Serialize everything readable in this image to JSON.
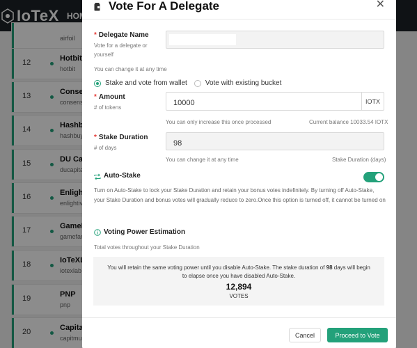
{
  "app": {
    "logo_text": "IoTeX",
    "nav_home": "HOM"
  },
  "list": {
    "top_sub": "airfoil",
    "rows": [
      {
        "rank": "12",
        "name": "Hotbit",
        "sub": "hotbit"
      },
      {
        "rank": "13",
        "name": "Consen",
        "sub": "consensu"
      },
      {
        "rank": "14",
        "name": "Hashbu",
        "sub": "hashbuy"
      },
      {
        "rank": "15",
        "name": "DU Cap",
        "sub": "ducapita"
      },
      {
        "rank": "16",
        "name": "Enlight",
        "sub": "enlightiv"
      },
      {
        "rank": "17",
        "name": "GameF",
        "sub": "gamefan"
      },
      {
        "rank": "18",
        "name": "IoTeXL",
        "sub": "iotexlab"
      },
      {
        "rank": "19",
        "name": "PNP",
        "sub": "pnp"
      },
      {
        "rank": "20",
        "name": "Capital",
        "sub": "capitmu"
      }
    ]
  },
  "modal": {
    "title": "Vote For A Delegate",
    "close": "✕",
    "delegate": {
      "label": "Delegate Name",
      "help": "Vote for a delegate or yourself",
      "hint": "You can change it at any time",
      "value": ""
    },
    "radio": {
      "option1": "Stake and vote from wallet",
      "option2": "Vote with existing bucket"
    },
    "amount": {
      "label": "Amount",
      "help": "# of tokens",
      "value": "10000",
      "suffix": "IOTX",
      "hint": "You can only increase this once processed",
      "balance": "Current balance 10033.54 IOTX"
    },
    "duration": {
      "label": "Stake Duration",
      "help": "# of days",
      "value": "98",
      "hint": "You can change it at any time",
      "hint_right": "Stake Duration (days)"
    },
    "auto_stake": {
      "title": "Auto-Stake",
      "enabled": true,
      "description": "Turn on Auto-Stake to lock your Stake Duration and retain your bonus votes indefinitely. By turning off Auto-Stake, your Stake Duration and bonus votes will gradually reduce to zero.Once this option is turned off, it cannot be turned on"
    },
    "estimation": {
      "title": "Voting Power Estimation",
      "subtitle": "Total votes throughout your Stake Duration",
      "text_part1": "You will retain the same voting power until you disable Auto-Stake. The stake duration of ",
      "days": "98",
      "text_part2": " days will begin to elapse once you have disabled Auto-Stake.",
      "votes": "12,894",
      "votes_unit": "VOTES"
    },
    "buttons": {
      "cancel": "Cancel",
      "proceed": "Proceed to Vote"
    }
  },
  "colors": {
    "accent": "#23a17a",
    "topbar": "#1d2227",
    "required": "#e53935"
  }
}
